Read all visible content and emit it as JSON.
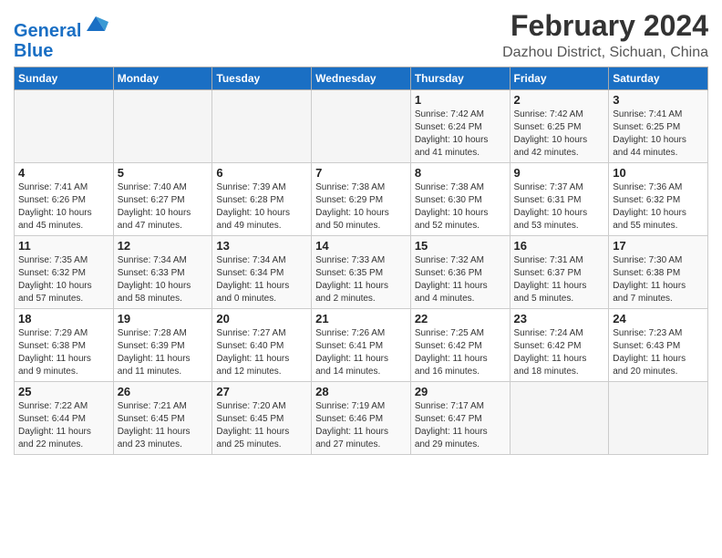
{
  "header": {
    "logo_general": "General",
    "logo_blue": "Blue",
    "main_title": "February 2024",
    "sub_title": "Dazhou District, Sichuan, China"
  },
  "weekdays": [
    "Sunday",
    "Monday",
    "Tuesday",
    "Wednesday",
    "Thursday",
    "Friday",
    "Saturday"
  ],
  "weeks": [
    [
      {
        "day": "",
        "info": ""
      },
      {
        "day": "",
        "info": ""
      },
      {
        "day": "",
        "info": ""
      },
      {
        "day": "",
        "info": ""
      },
      {
        "day": "1",
        "info": "Sunrise: 7:42 AM\nSunset: 6:24 PM\nDaylight: 10 hours\nand 41 minutes."
      },
      {
        "day": "2",
        "info": "Sunrise: 7:42 AM\nSunset: 6:25 PM\nDaylight: 10 hours\nand 42 minutes."
      },
      {
        "day": "3",
        "info": "Sunrise: 7:41 AM\nSunset: 6:25 PM\nDaylight: 10 hours\nand 44 minutes."
      }
    ],
    [
      {
        "day": "4",
        "info": "Sunrise: 7:41 AM\nSunset: 6:26 PM\nDaylight: 10 hours\nand 45 minutes."
      },
      {
        "day": "5",
        "info": "Sunrise: 7:40 AM\nSunset: 6:27 PM\nDaylight: 10 hours\nand 47 minutes."
      },
      {
        "day": "6",
        "info": "Sunrise: 7:39 AM\nSunset: 6:28 PM\nDaylight: 10 hours\nand 49 minutes."
      },
      {
        "day": "7",
        "info": "Sunrise: 7:38 AM\nSunset: 6:29 PM\nDaylight: 10 hours\nand 50 minutes."
      },
      {
        "day": "8",
        "info": "Sunrise: 7:38 AM\nSunset: 6:30 PM\nDaylight: 10 hours\nand 52 minutes."
      },
      {
        "day": "9",
        "info": "Sunrise: 7:37 AM\nSunset: 6:31 PM\nDaylight: 10 hours\nand 53 minutes."
      },
      {
        "day": "10",
        "info": "Sunrise: 7:36 AM\nSunset: 6:32 PM\nDaylight: 10 hours\nand 55 minutes."
      }
    ],
    [
      {
        "day": "11",
        "info": "Sunrise: 7:35 AM\nSunset: 6:32 PM\nDaylight: 10 hours\nand 57 minutes."
      },
      {
        "day": "12",
        "info": "Sunrise: 7:34 AM\nSunset: 6:33 PM\nDaylight: 10 hours\nand 58 minutes."
      },
      {
        "day": "13",
        "info": "Sunrise: 7:34 AM\nSunset: 6:34 PM\nDaylight: 11 hours\nand 0 minutes."
      },
      {
        "day": "14",
        "info": "Sunrise: 7:33 AM\nSunset: 6:35 PM\nDaylight: 11 hours\nand 2 minutes."
      },
      {
        "day": "15",
        "info": "Sunrise: 7:32 AM\nSunset: 6:36 PM\nDaylight: 11 hours\nand 4 minutes."
      },
      {
        "day": "16",
        "info": "Sunrise: 7:31 AM\nSunset: 6:37 PM\nDaylight: 11 hours\nand 5 minutes."
      },
      {
        "day": "17",
        "info": "Sunrise: 7:30 AM\nSunset: 6:38 PM\nDaylight: 11 hours\nand 7 minutes."
      }
    ],
    [
      {
        "day": "18",
        "info": "Sunrise: 7:29 AM\nSunset: 6:38 PM\nDaylight: 11 hours\nand 9 minutes."
      },
      {
        "day": "19",
        "info": "Sunrise: 7:28 AM\nSunset: 6:39 PM\nDaylight: 11 hours\nand 11 minutes."
      },
      {
        "day": "20",
        "info": "Sunrise: 7:27 AM\nSunset: 6:40 PM\nDaylight: 11 hours\nand 12 minutes."
      },
      {
        "day": "21",
        "info": "Sunrise: 7:26 AM\nSunset: 6:41 PM\nDaylight: 11 hours\nand 14 minutes."
      },
      {
        "day": "22",
        "info": "Sunrise: 7:25 AM\nSunset: 6:42 PM\nDaylight: 11 hours\nand 16 minutes."
      },
      {
        "day": "23",
        "info": "Sunrise: 7:24 AM\nSunset: 6:42 PM\nDaylight: 11 hours\nand 18 minutes."
      },
      {
        "day": "24",
        "info": "Sunrise: 7:23 AM\nSunset: 6:43 PM\nDaylight: 11 hours\nand 20 minutes."
      }
    ],
    [
      {
        "day": "25",
        "info": "Sunrise: 7:22 AM\nSunset: 6:44 PM\nDaylight: 11 hours\nand 22 minutes."
      },
      {
        "day": "26",
        "info": "Sunrise: 7:21 AM\nSunset: 6:45 PM\nDaylight: 11 hours\nand 23 minutes."
      },
      {
        "day": "27",
        "info": "Sunrise: 7:20 AM\nSunset: 6:45 PM\nDaylight: 11 hours\nand 25 minutes."
      },
      {
        "day": "28",
        "info": "Sunrise: 7:19 AM\nSunset: 6:46 PM\nDaylight: 11 hours\nand 27 minutes."
      },
      {
        "day": "29",
        "info": "Sunrise: 7:17 AM\nSunset: 6:47 PM\nDaylight: 11 hours\nand 29 minutes."
      },
      {
        "day": "",
        "info": ""
      },
      {
        "day": "",
        "info": ""
      }
    ]
  ]
}
